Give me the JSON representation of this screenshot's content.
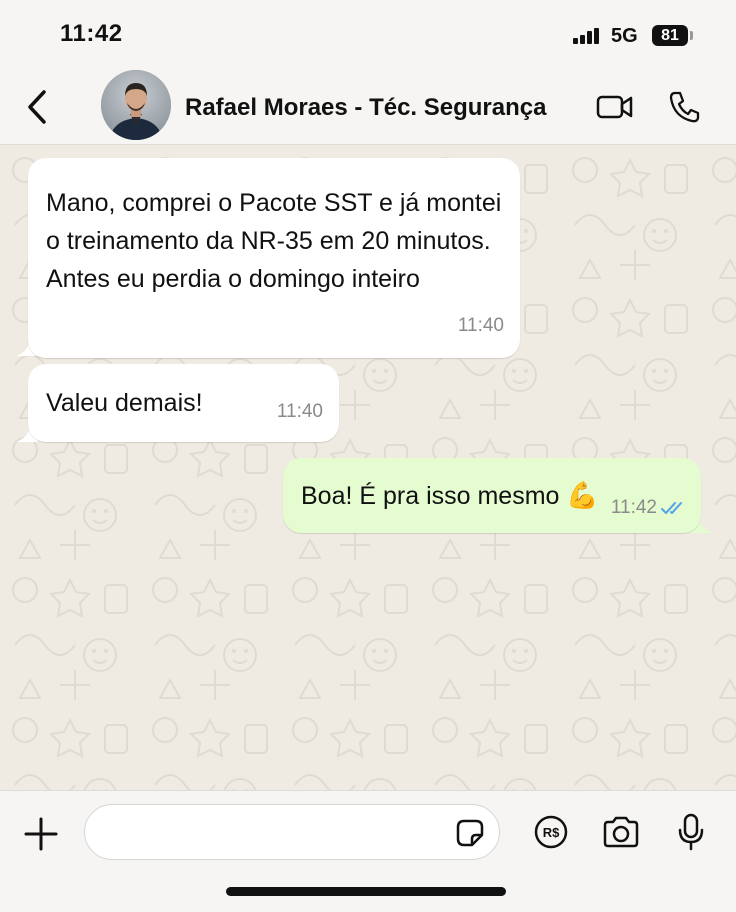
{
  "status_bar": {
    "time": "11:42",
    "network": "5G",
    "battery": "81",
    "signal_icon": "signal-bars-icon"
  },
  "header": {
    "contact_name": "Rafael Moraes - Téc. Segurança",
    "back_icon": "chevron-left-icon",
    "video_icon": "video-camera-icon",
    "call_icon": "phone-icon"
  },
  "messages": [
    {
      "direction": "incoming",
      "text": "Mano, comprei o Pacote SST e já montei o treinamento da NR-35 em 20 minutos. Antes eu perdia o domingo inteiro",
      "time": "11:40"
    },
    {
      "direction": "incoming",
      "text": "Valeu demais!",
      "time": "11:40"
    },
    {
      "direction": "outgoing",
      "text": "Boa! É pra isso mesmo",
      "emoji": "💪",
      "time": "11:42",
      "status": "read"
    }
  ],
  "input_bar": {
    "placeholder": "",
    "value": "",
    "icons": [
      "plus-icon",
      "sticker-icon",
      "payment-icon",
      "camera-icon",
      "microphone-icon"
    ],
    "payment_label": "R$"
  },
  "colors": {
    "incoming_bubble": "#ffffff",
    "outgoing_bubble": "#e5fcd1",
    "wallpaper": "#efeae2",
    "read_ticks": "#4fa3e8"
  }
}
